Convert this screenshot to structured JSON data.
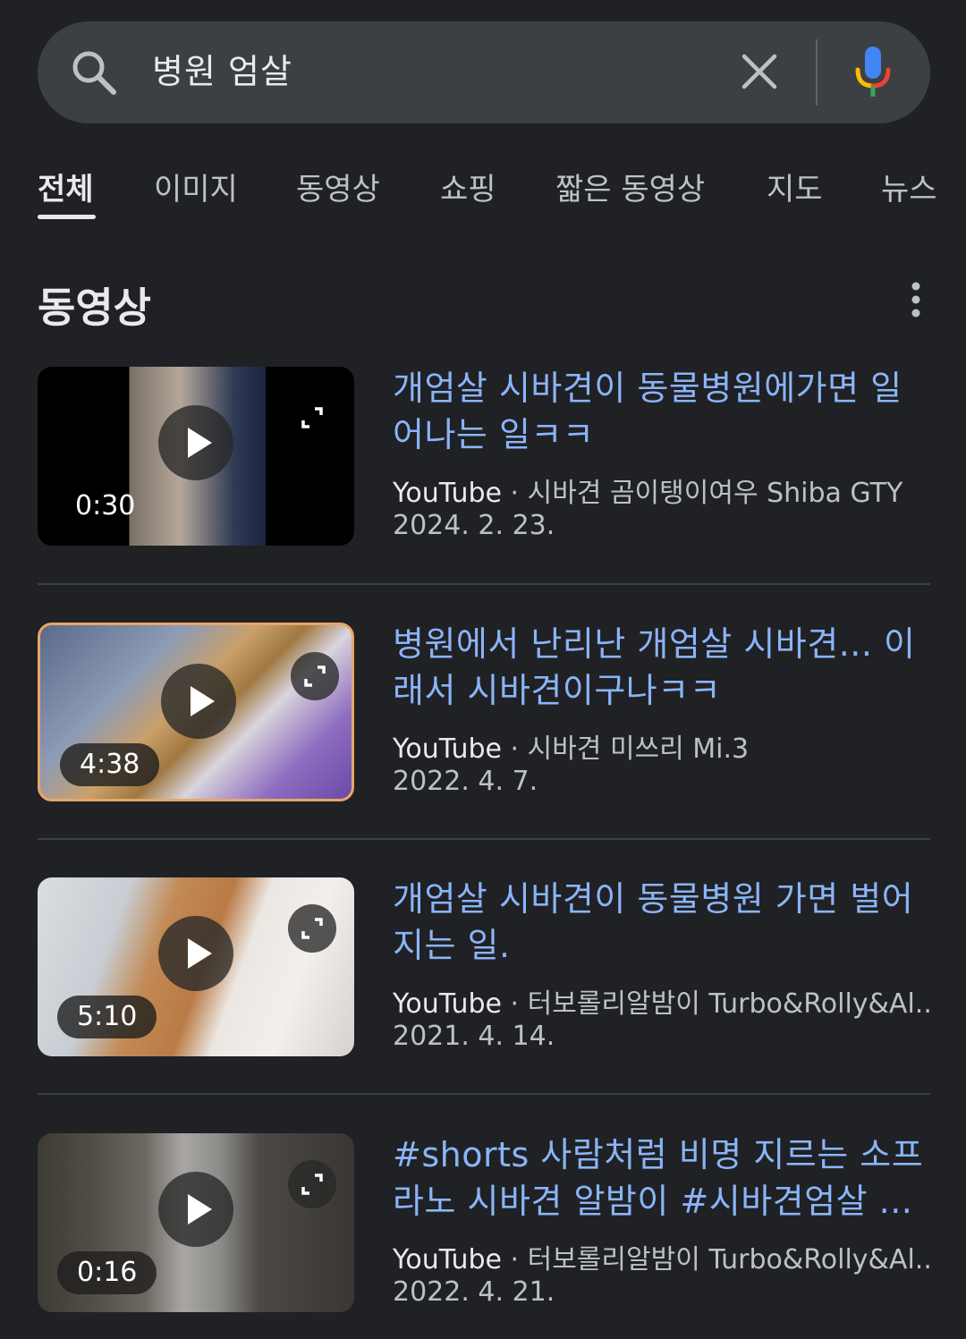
{
  "search": {
    "query": "병원 엄살"
  },
  "tabs": [
    {
      "label": "전체",
      "active": true
    },
    {
      "label": "이미지"
    },
    {
      "label": "동영상"
    },
    {
      "label": "쇼핑"
    },
    {
      "label": "짧은 동영상"
    },
    {
      "label": "지도"
    },
    {
      "label": "뉴스"
    }
  ],
  "section": {
    "title": "동영상"
  },
  "results": [
    {
      "title": "개엄살 시바견이 동물병원에가면 일어나는 일ㅋㅋ",
      "duration": "0:30",
      "source": "YouTube",
      "separator": " · ",
      "channel": "시바견 곰이탱이여우 Shiba GTY",
      "date": "2024. 2. 23."
    },
    {
      "title": "병원에서 난리난 개엄살 시바견... 이래서 시바견이구나ㅋㅋ",
      "duration": "4:38",
      "source": "YouTube",
      "separator": " · ",
      "channel": "시바견 미쓰리 Mi.3",
      "date": "2022. 4. 7."
    },
    {
      "title": "개엄살 시바견이 동물병원 가면 벌어지는 일.",
      "duration": "5:10",
      "source": "YouTube",
      "separator": " · ",
      "channel": "터보롤리알밤이 Turbo&Rolly&Al...",
      "date": "2021. 4. 14."
    },
    {
      "title": "#shorts 사람처럼 비명 지르는 소프라노 시바견 알밤이 #시바견엄살 ...",
      "duration": "0:16",
      "source": "YouTube",
      "separator": " · ",
      "channel": "터보롤리알밤이 Turbo&Rolly&Al...",
      "date": "2022. 4. 21."
    }
  ]
}
